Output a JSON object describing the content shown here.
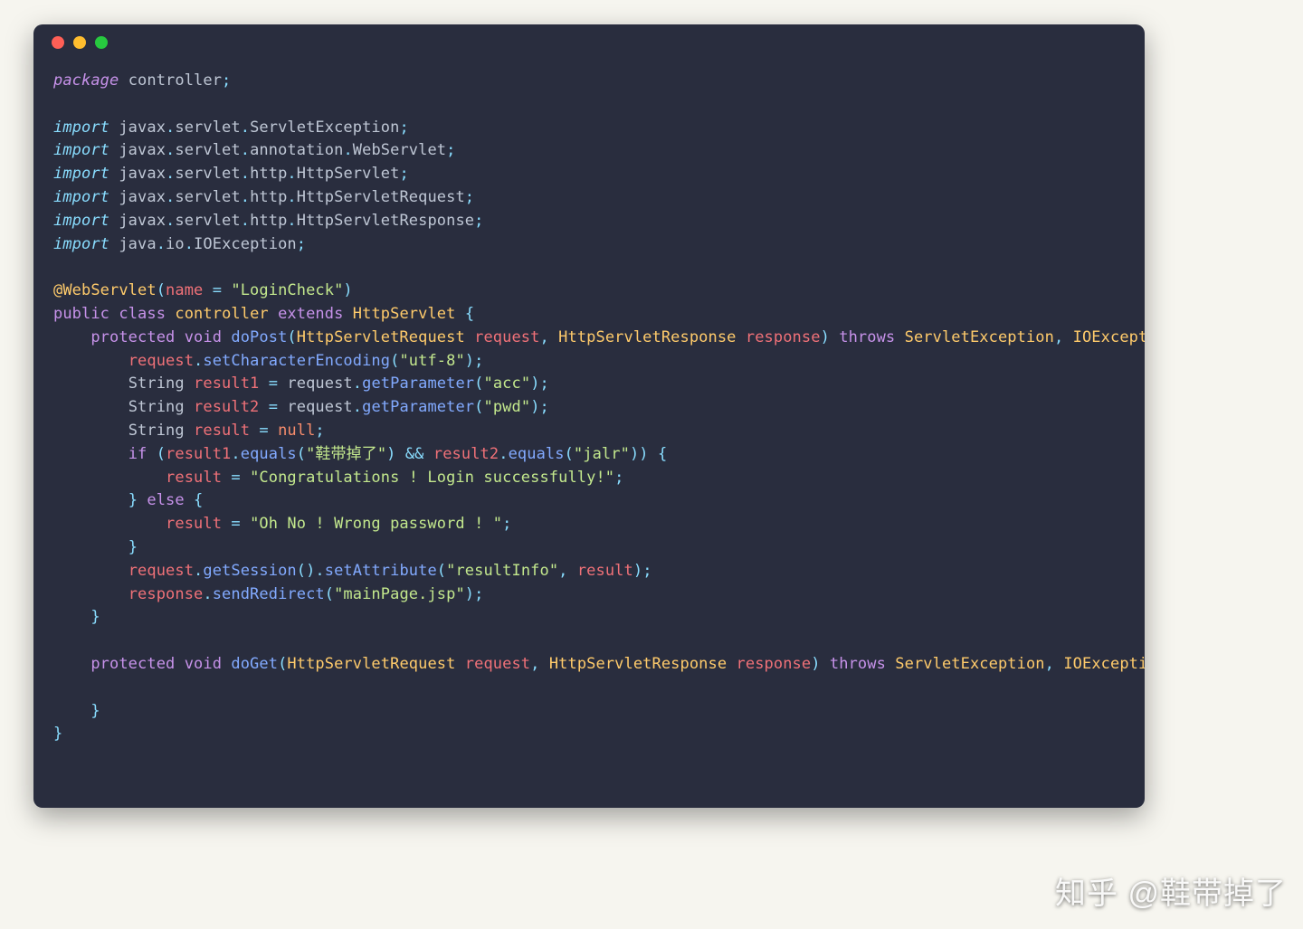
{
  "watermark": "知乎 @鞋带掉了",
  "colors": {
    "background_page": "#f6f5ef",
    "background_editor": "#292d3e",
    "keyword": "#c792ea",
    "type": "#ffcb6b",
    "function": "#82aaff",
    "string": "#c3e88d",
    "literal": "#f78c6c",
    "operator": "#89ddff",
    "param": "#f07178",
    "default_text": "#bfc7d5",
    "traffic_red": "#ff5f56",
    "traffic_yellow": "#ffbd2e",
    "traffic_green": "#27c93f"
  },
  "code": {
    "line01": {
      "a": "package",
      "b": " controller",
      "c": ";"
    },
    "line03": {
      "a": "import",
      "b": " javax",
      "c": ".",
      "d": "servlet",
      "e": ".",
      "f": "ServletException",
      "g": ";"
    },
    "line04": {
      "a": "import",
      "b": " javax",
      "c": ".",
      "d": "servlet",
      "e": ".",
      "f": "annotation",
      "g": ".",
      "h": "WebServlet",
      "i": ";"
    },
    "line05": {
      "a": "import",
      "b": " javax",
      "c": ".",
      "d": "servlet",
      "e": ".",
      "f": "http",
      "g": ".",
      "h": "HttpServlet",
      "i": ";"
    },
    "line06": {
      "a": "import",
      "b": " javax",
      "c": ".",
      "d": "servlet",
      "e": ".",
      "f": "http",
      "g": ".",
      "h": "HttpServletRequest",
      "i": ";"
    },
    "line07": {
      "a": "import",
      "b": " javax",
      "c": ".",
      "d": "servlet",
      "e": ".",
      "f": "http",
      "g": ".",
      "h": "HttpServletResponse",
      "i": ";"
    },
    "line08": {
      "a": "import",
      "b": " java",
      "c": ".",
      "d": "io",
      "e": ".",
      "f": "IOException",
      "g": ";"
    },
    "line10": {
      "a": "@WebServlet",
      "b": "(",
      "c": "name",
      "d": " = ",
      "e": "\"LoginCheck\"",
      "f": ")"
    },
    "line11": {
      "a": "public",
      "b": " ",
      "c": "class",
      "d": " ",
      "e": "controller",
      "f": " ",
      "g": "extends",
      "h": " ",
      "i": "HttpServlet",
      "j": " {"
    },
    "line12": {
      "ind": "    ",
      "a": "protected",
      "b": " ",
      "c": "void",
      "d": " ",
      "e": "doPost",
      "f": "(",
      "g": "HttpServletRequest",
      "h": " ",
      "i": "request",
      "j": ", ",
      "k": "HttpServletResponse",
      "l": " ",
      "m": "response",
      "n": ")",
      "o": " ",
      "p": "throws",
      "q": " ",
      "r": "ServletException",
      "s": ", ",
      "t": "IOException",
      "u": " {"
    },
    "line13": {
      "ind": "        ",
      "a": "request",
      "b": ".",
      "c": "setCharacterEncoding",
      "d": "(",
      "e": "\"utf-8\"",
      "f": ");"
    },
    "line14": {
      "ind": "        ",
      "a": "String ",
      "b": "result1",
      "c": " = ",
      "d": "request",
      "e": ".",
      "f": "getParameter",
      "g": "(",
      "h": "\"acc\"",
      "i": ");"
    },
    "line15": {
      "ind": "        ",
      "a": "String ",
      "b": "result2",
      "c": " = ",
      "d": "request",
      "e": ".",
      "f": "getParameter",
      "g": "(",
      "h": "\"pwd\"",
      "i": ");"
    },
    "line16": {
      "ind": "        ",
      "a": "String ",
      "b": "result",
      "c": " = ",
      "d": "null",
      "e": ";"
    },
    "line17": {
      "ind": "        ",
      "a": "if",
      "b": " (",
      "c": "result1",
      "d": ".",
      "e": "equals",
      "f": "(",
      "g": "\"鞋带掉了\"",
      "h": ") ",
      "i": "&&",
      "j": " ",
      "k": "result2",
      "l": ".",
      "m": "equals",
      "n": "(",
      "o": "\"jalr\"",
      "p": ")) {"
    },
    "line18": {
      "ind": "            ",
      "a": "result",
      "b": " = ",
      "c": "\"Congratulations ! Login successfully!\"",
      "d": ";"
    },
    "line19": {
      "ind": "        ",
      "a": "} ",
      "b": "else",
      "c": " {"
    },
    "line20": {
      "ind": "            ",
      "a": "result",
      "b": " = ",
      "c": "\"Oh No ! Wrong password ! \"",
      "d": ";"
    },
    "line21": {
      "ind": "        ",
      "a": "}"
    },
    "line22": {
      "ind": "        ",
      "a": "request",
      "b": ".",
      "c": "getSession",
      "d": "().",
      "e": "setAttribute",
      "f": "(",
      "g": "\"resultInfo\"",
      "h": ", ",
      "i": "result",
      "j": ");"
    },
    "line23": {
      "ind": "        ",
      "a": "response",
      "b": ".",
      "c": "sendRedirect",
      "d": "(",
      "e": "\"mainPage.jsp\"",
      "f": ");"
    },
    "line24": {
      "ind": "    ",
      "a": "}"
    },
    "line26": {
      "ind": "    ",
      "a": "protected",
      "b": " ",
      "c": "void",
      "d": " ",
      "e": "doGet",
      "f": "(",
      "g": "HttpServletRequest",
      "h": " ",
      "i": "request",
      "j": ", ",
      "k": "HttpServletResponse",
      "l": " ",
      "m": "response",
      "n": ")",
      "o": " ",
      "p": "throws",
      "q": " ",
      "r": "ServletException",
      "s": ", ",
      "t": "IOException",
      "u": " {"
    },
    "line28": {
      "ind": "    ",
      "a": "}"
    },
    "line29": {
      "a": "}"
    }
  }
}
